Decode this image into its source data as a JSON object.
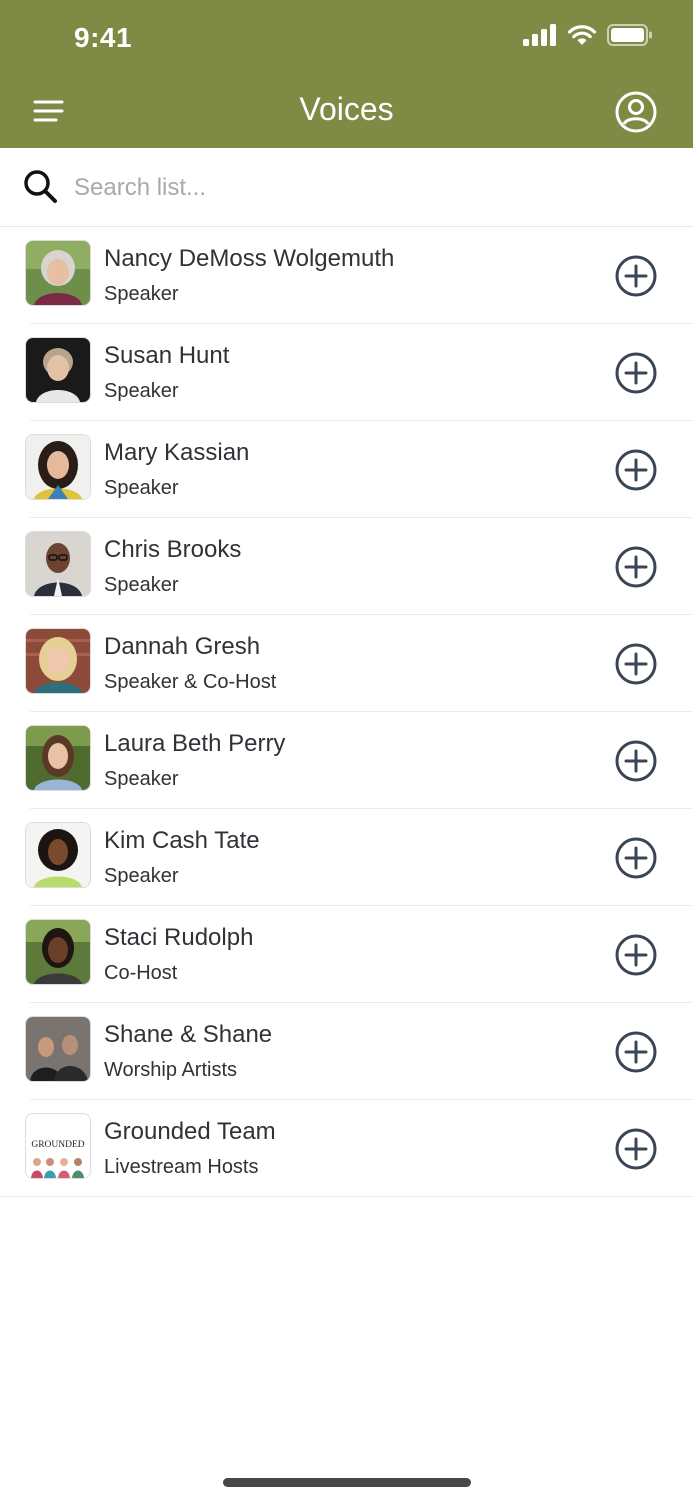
{
  "status_bar": {
    "time": "9:41"
  },
  "header": {
    "title": "Voices",
    "background": "#7f8a45"
  },
  "search": {
    "placeholder": "Search list...",
    "value": ""
  },
  "voices": [
    {
      "name": "Nancy DeMoss Wolgemuth",
      "role": "Speaker"
    },
    {
      "name": "Susan Hunt",
      "role": "Speaker"
    },
    {
      "name": "Mary Kassian",
      "role": "Speaker"
    },
    {
      "name": "Chris Brooks",
      "role": "Speaker"
    },
    {
      "name": "Dannah Gresh",
      "role": "Speaker & Co-Host"
    },
    {
      "name": "Laura Beth Perry",
      "role": "Speaker"
    },
    {
      "name": "Kim Cash Tate",
      "role": "Speaker"
    },
    {
      "name": "Staci Rudolph",
      "role": "Co-Host"
    },
    {
      "name": "Shane & Shane",
      "role": "Worship Artists"
    },
    {
      "name": "Grounded Team",
      "role": "Livestream Hosts",
      "logo_text": "GROUNDED"
    }
  ]
}
